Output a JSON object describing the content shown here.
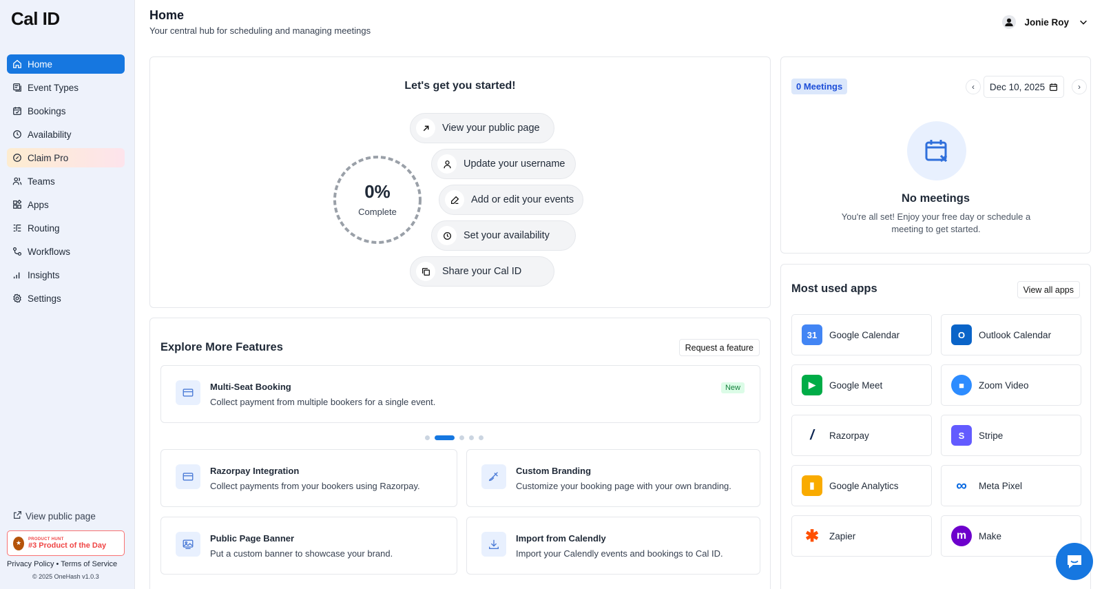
{
  "app": {
    "logo": "Cal ID"
  },
  "sidebar": {
    "items": [
      {
        "label": "Home",
        "icon": "home-icon"
      },
      {
        "label": "Event Types",
        "icon": "event-types-icon"
      },
      {
        "label": "Bookings",
        "icon": "calendar-icon"
      },
      {
        "label": "Availability",
        "icon": "clock-icon"
      },
      {
        "label": "Claim Pro",
        "icon": "badge-icon"
      },
      {
        "label": "Teams",
        "icon": "users-icon"
      },
      {
        "label": "Apps",
        "icon": "grid-icon"
      },
      {
        "label": "Routing",
        "icon": "routing-icon"
      },
      {
        "label": "Workflows",
        "icon": "workflow-icon"
      },
      {
        "label": "Insights",
        "icon": "chart-icon"
      },
      {
        "label": "Settings",
        "icon": "gear-icon"
      }
    ],
    "view_public_page": "View public page",
    "product_hunt": {
      "top": "PRODUCT HUNT",
      "label": "#3 Product of the Day"
    },
    "privacy": "Privacy Policy",
    "separator": "•",
    "terms": "Terms of Service",
    "copyright": "© 2025 OneHash v1.0.3"
  },
  "header": {
    "title": "Home",
    "subtitle": "Your central hub for scheduling and managing meetings",
    "user_name": "Jonie Roy"
  },
  "getting_started": {
    "title": "Let's get you started!",
    "progress_value": 0,
    "progress_text": "0%",
    "progress_label": "Complete",
    "steps": [
      {
        "label": "View your public page",
        "icon": "arrow-up-right-icon"
      },
      {
        "label": "Update your username",
        "icon": "user-icon"
      },
      {
        "label": "Add or edit your events",
        "icon": "pencil-icon"
      },
      {
        "label": "Set your availability",
        "icon": "clock-icon"
      },
      {
        "label": "Share your Cal ID",
        "icon": "copy-icon"
      }
    ]
  },
  "explore": {
    "title": "Explore More Features",
    "request_button": "Request a feature",
    "featured": {
      "title": "Multi-Seat Booking",
      "desc": "Collect payment from multiple bookers for a single event.",
      "badge": "New"
    },
    "carousel_active": 1,
    "carousel_count": 5,
    "features": [
      {
        "title": "Razorpay Integration",
        "desc": "Collect payments from your bookers using Razorpay."
      },
      {
        "title": "Custom Branding",
        "desc": "Customize your booking page with your own branding."
      },
      {
        "title": "Public Page Banner",
        "desc": "Put a custom banner to showcase your brand."
      },
      {
        "title": "Import from Calendly",
        "desc": "Import your Calendly events and bookings to Cal ID."
      }
    ]
  },
  "meetings": {
    "badge": "0 Meetings",
    "date": "Dec 10, 2025",
    "empty_title": "No meetings",
    "empty_desc": "You're all set! Enjoy your free day or schedule a meeting to get started."
  },
  "apps": {
    "title": "Most used apps",
    "view_all": "View all apps",
    "items": [
      {
        "name": "Google Calendar",
        "color": "#4285f4",
        "glyph": "31"
      },
      {
        "name": "Outlook Calendar",
        "color": "#0a64c8",
        "glyph": "O"
      },
      {
        "name": "Google Meet",
        "color": "#00ac47",
        "glyph": "▶"
      },
      {
        "name": "Zoom Video",
        "color": "#2d8cff",
        "glyph": "■"
      },
      {
        "name": "Razorpay",
        "color": "#0c2451",
        "glyph": "/"
      },
      {
        "name": "Stripe",
        "color": "#635bff",
        "glyph": "S"
      },
      {
        "name": "Google Analytics",
        "color": "#f9ab00",
        "glyph": "▮"
      },
      {
        "name": "Meta Pixel",
        "color": "#0668e1",
        "glyph": "∞"
      },
      {
        "name": "Zapier",
        "color": "#ff4f00",
        "glyph": "✱"
      },
      {
        "name": "Make",
        "color": "#6d00cc",
        "glyph": "m"
      }
    ]
  }
}
